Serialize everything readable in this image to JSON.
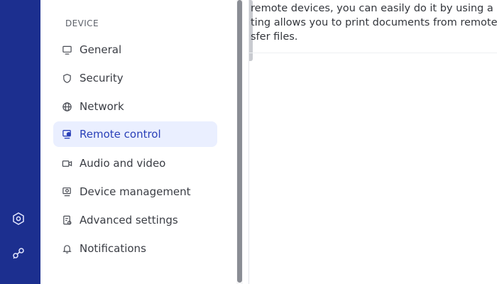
{
  "rail": {
    "background": "#1c2f8f",
    "icons": [
      "settings-hex-icon",
      "nodes-icon"
    ]
  },
  "sidebar": {
    "section_label": "DEVICE",
    "items": [
      {
        "label": "General",
        "icon": "monitor-icon",
        "active": false
      },
      {
        "label": "Security",
        "icon": "shield-icon",
        "active": false
      },
      {
        "label": "Network",
        "icon": "globe-icon",
        "active": false
      },
      {
        "label": "Remote control",
        "icon": "remote-control-icon",
        "active": true
      },
      {
        "label": "Audio and video",
        "icon": "video-camera-icon",
        "active": false
      },
      {
        "label": "Device management",
        "icon": "device-management-icon",
        "active": false
      },
      {
        "label": "Advanced settings",
        "icon": "advanced-settings-icon",
        "active": false
      },
      {
        "label": "Notifications",
        "icon": "bell-icon",
        "active": false
      }
    ],
    "active_color": "#2a40b8",
    "active_background": "#eaefff"
  },
  "main": {
    "paragraph_lines": [
      "remote devices, you can easily do it by using a p",
      "ting allows you to print documents from remote d",
      "sfer files."
    ]
  }
}
